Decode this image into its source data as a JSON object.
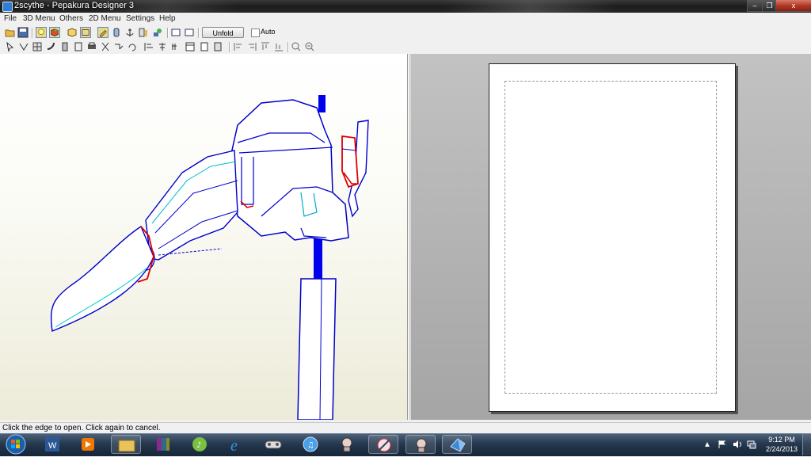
{
  "window": {
    "title": "2scythe - Pepakura Designer 3",
    "controls": {
      "minimize": "–",
      "maximize": "❐",
      "close": "x"
    }
  },
  "menu": [
    "File",
    "3D Menu",
    "Others",
    "2D Menu",
    "Settings",
    "Help"
  ],
  "toolbar": {
    "unfold_label": "Unfold",
    "auto_label": "Auto",
    "auto_checked": false
  },
  "status": {
    "text": "Click the edge to open. Click again to cancel."
  },
  "taskbar": {
    "pinned": [
      "start-orb",
      "word-icon",
      "media-player-icon",
      "explorer-folder-icon",
      "winrar-icon",
      "itunes-icon",
      "internet-explorer-icon",
      "gamepad-icon",
      "itunes-disc-icon",
      "game-character-icon",
      "paint-tool-icon",
      "game-character-icon",
      "pepakura-icon"
    ],
    "clock_time": "9:12 PM",
    "clock_date": "2/24/2013",
    "tray_arrow": "▲"
  },
  "colors": {
    "model_edge": "#0000cc",
    "cut_edge": "#dd0000",
    "fold_edge": "#00cccc",
    "handle_fill": "#0000ee"
  }
}
